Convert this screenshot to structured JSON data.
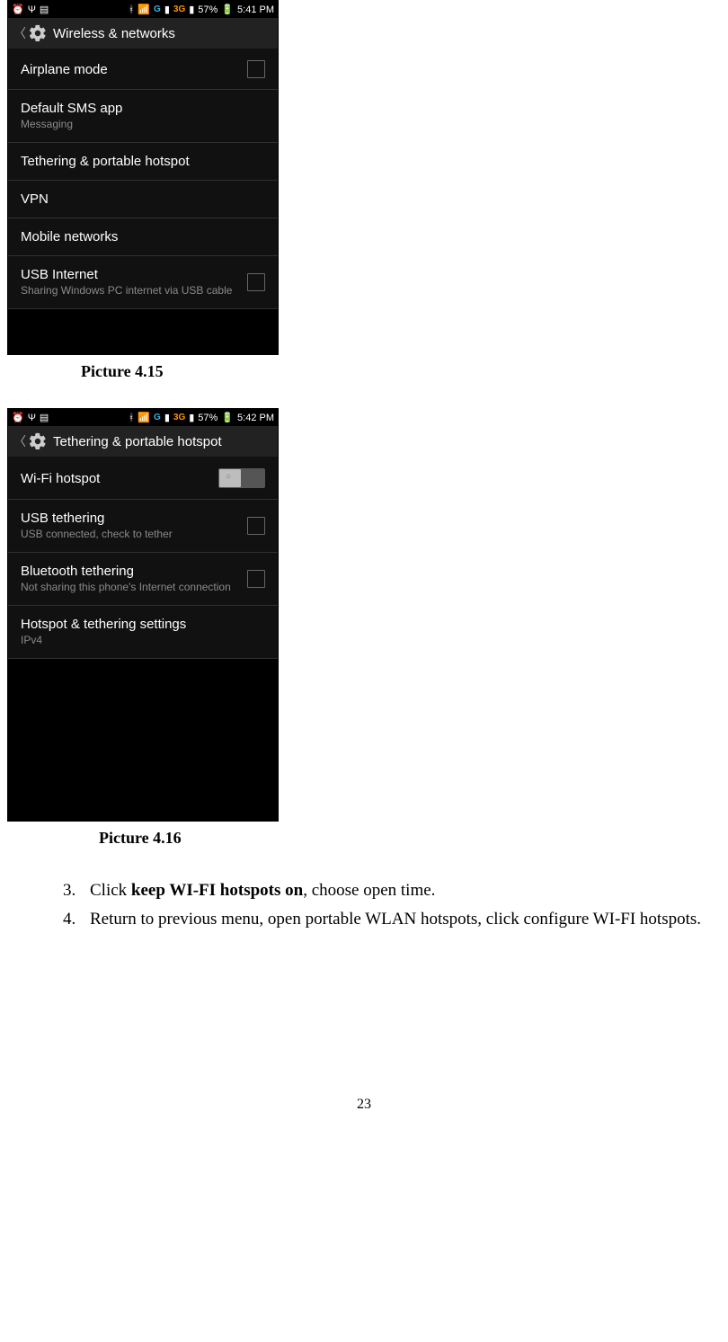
{
  "statusbar": {
    "battery": "57%",
    "time1": "5:41 PM",
    "time2": "5:42 PM",
    "net_g": "G",
    "net_3g": "3G"
  },
  "screen1": {
    "title": "Wireless & networks",
    "items": {
      "airplane": {
        "title": "Airplane mode"
      },
      "sms": {
        "title": "Default SMS app",
        "sub": "Messaging"
      },
      "tether": {
        "title": "Tethering & portable hotspot"
      },
      "vpn": {
        "title": "VPN"
      },
      "mobile": {
        "title": "Mobile networks"
      },
      "usb": {
        "title": "USB Internet",
        "sub": "Sharing Windows PC internet via USB cable"
      }
    }
  },
  "screen2": {
    "title": "Tethering & portable hotspot",
    "items": {
      "wifi": {
        "title": "Wi-Fi hotspot"
      },
      "usb": {
        "title": "USB tethering",
        "sub": "USB connected, check to tether"
      },
      "bt": {
        "title": "Bluetooth tethering",
        "sub": "Not sharing this phone's Internet connection"
      },
      "cfg": {
        "title": "Hotspot & tethering settings",
        "sub": "IPv4"
      }
    }
  },
  "captions": {
    "c1": "Picture 4.15",
    "c2": "Picture 4.16"
  },
  "steps": {
    "s3_num": "3.",
    "s3_pre": "Click ",
    "s3_bold": "keep WI-FI hotspots on",
    "s3_post": ", choose open time.",
    "s4_num": "4.",
    "s4_text": "Return to previous menu, open portable WLAN hotspots, click configure WI-FI hotspots."
  },
  "page_number": "23"
}
